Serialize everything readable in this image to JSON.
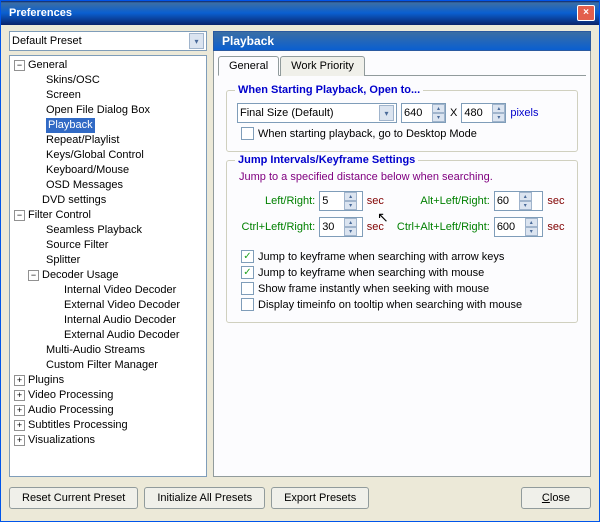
{
  "window": {
    "title": "Preferences"
  },
  "preset": {
    "selected": "Default Preset"
  },
  "tree": {
    "general": "General",
    "skins": "Skins/OSC",
    "screen": "Screen",
    "openfile": "Open File Dialog Box",
    "playback": "Playback",
    "repeat": "Repeat/Playlist",
    "keysglobal": "Keys/Global Control",
    "keyboard": "Keyboard/Mouse",
    "osd": "OSD Messages",
    "dvd": "DVD settings",
    "filtercontrol": "Filter Control",
    "seamless": "Seamless Playback",
    "sourcefilter": "Source Filter",
    "splitter": "Splitter",
    "decoderusage": "Decoder Usage",
    "intvideo": "Internal Video Decoder",
    "extvideo": "External Video Decoder",
    "intaudio": "Internal Audio Decoder",
    "extaudio": "External Audio Decoder",
    "multiaudio": "Multi-Audio Streams",
    "customfilter": "Custom Filter Manager",
    "plugins": "Plugins",
    "videoproc": "Video Processing",
    "audioproc": "Audio Processing",
    "subtitles": "Subtitles Processing",
    "visual": "Visualizations"
  },
  "panel": {
    "title": "Playback"
  },
  "tabs": {
    "general": "General",
    "work": "Work Priority"
  },
  "open": {
    "legend": "When Starting Playback, Open to...",
    "size_mode": "Final Size (Default)",
    "w": "640",
    "x": "X",
    "h": "480",
    "pixels": "pixels",
    "desktop": "When starting playback, go to Desktop Mode"
  },
  "jump": {
    "legend": "Jump Intervals/Keyframe Settings",
    "desc": "Jump to a specified distance below when searching.",
    "lr_label": "Left/Right:",
    "lr_val": "5",
    "alt_label": "Alt+Left/Right:",
    "alt_val": "60",
    "ctrl_label": "Ctrl+Left/Right:",
    "ctrl_val": "30",
    "ctrlalt_label": "Ctrl+Alt+Left/Right:",
    "ctrlalt_val": "600",
    "sec": "sec",
    "chk_arrow": "Jump to keyframe when searching with arrow keys",
    "chk_mouse": "Jump to keyframe when searching with mouse",
    "chk_show": "Show frame instantly when seeking with mouse",
    "chk_tooltip": "Display timeinfo on tooltip when searching with mouse"
  },
  "footer": {
    "reset": "Reset Current Preset",
    "init": "Initialize All Presets",
    "export": "Export Presets",
    "close": "Close"
  },
  "icons": {
    "close": "×",
    "minus": "−",
    "plus": "+",
    "down": "▾",
    "up": "▴",
    "check": "✓"
  }
}
